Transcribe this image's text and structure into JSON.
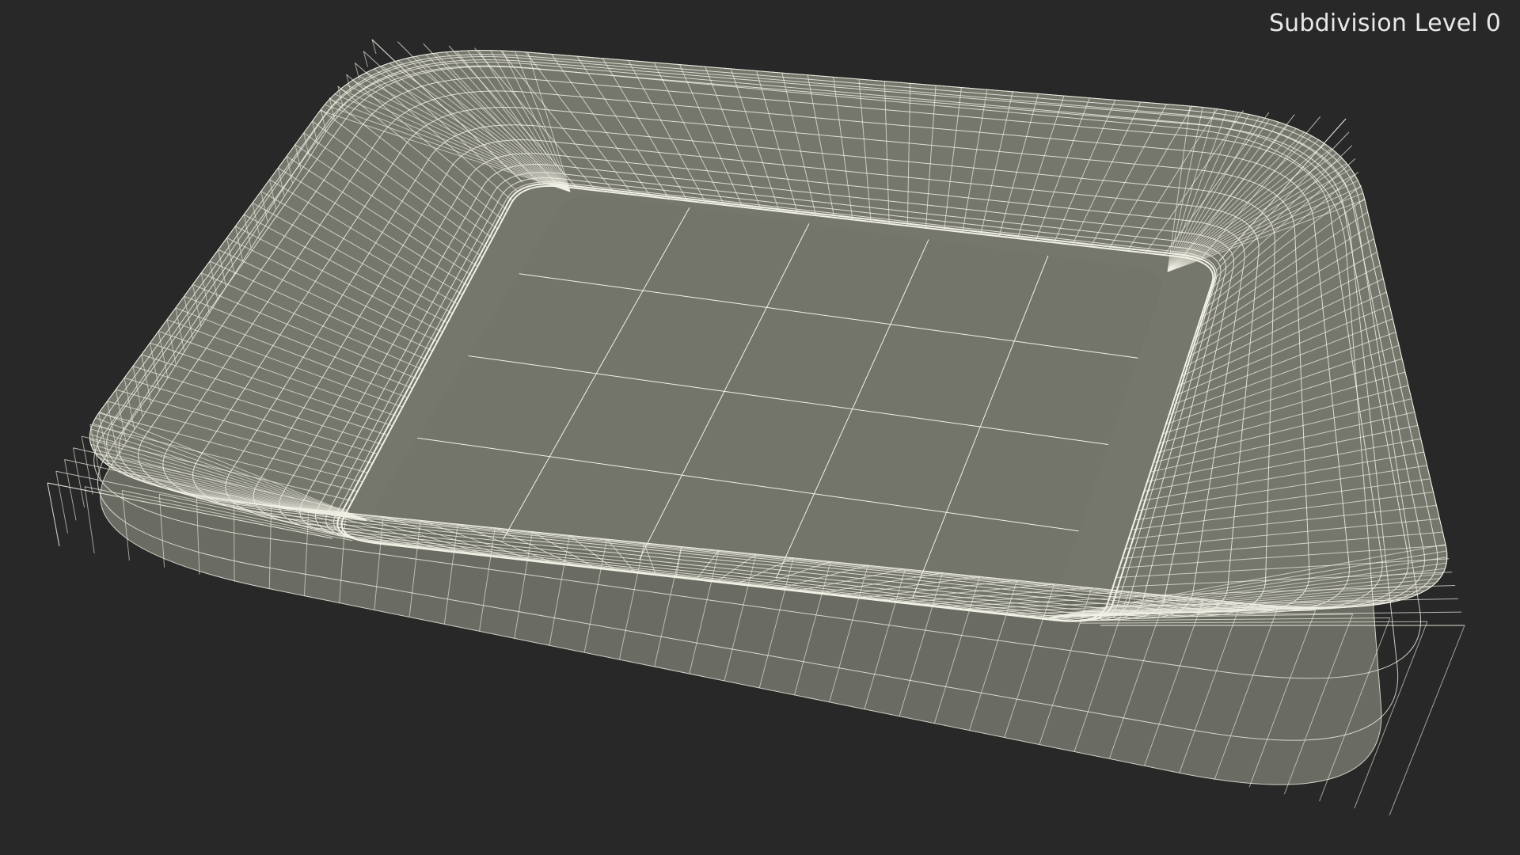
{
  "viewport": {
    "label": "Subdivision Level 0",
    "background_color": "#282828",
    "surface_color": "#75766c",
    "side_color": "#6a6b62",
    "wire_color": "#f2f1e6"
  },
  "model": {
    "subject": "tray-wireframe"
  }
}
